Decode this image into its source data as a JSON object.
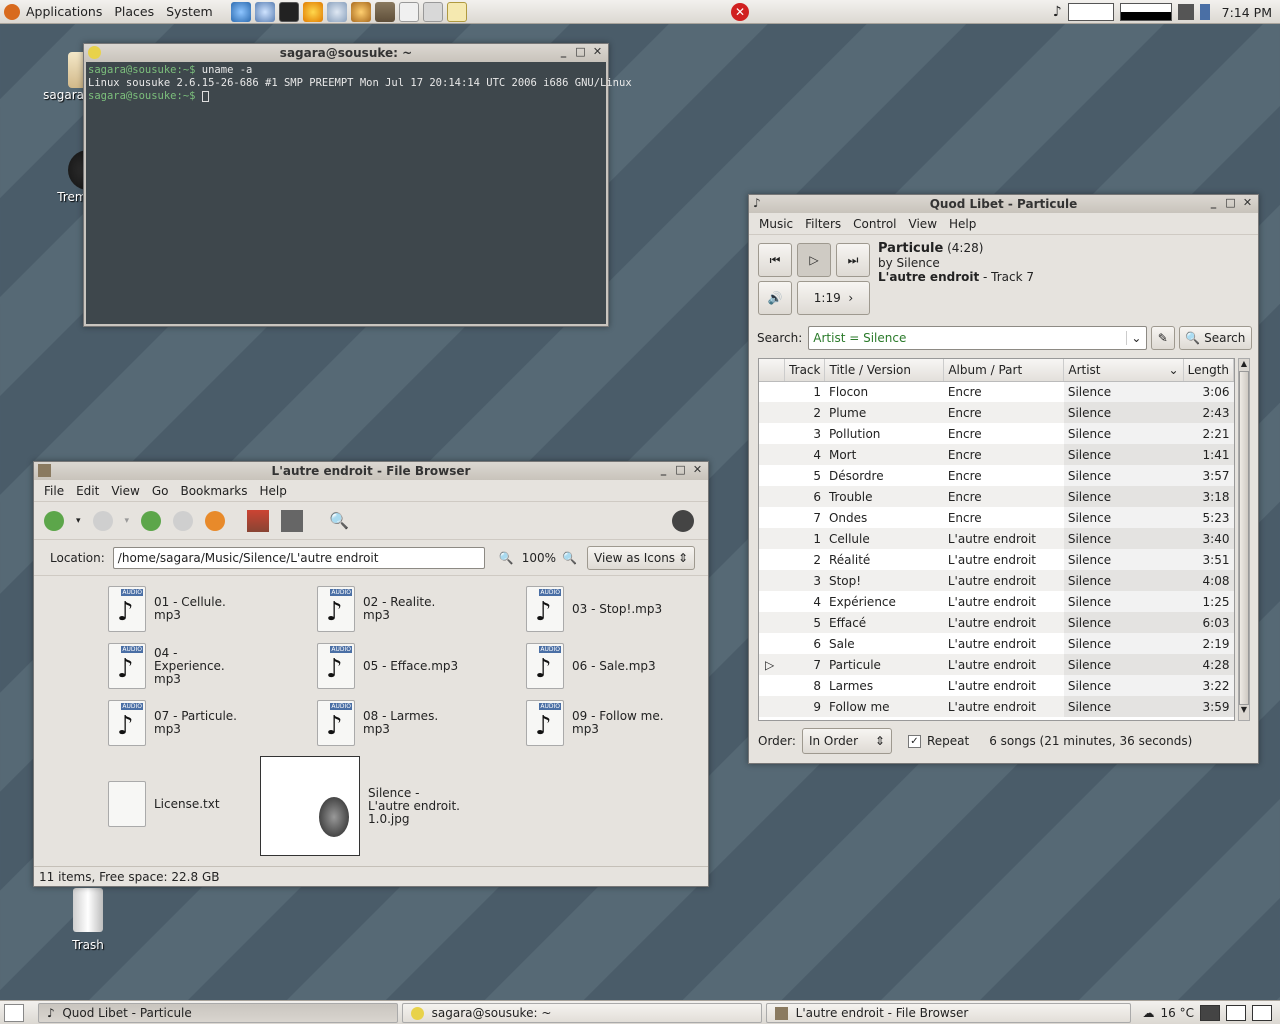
{
  "top_panel": {
    "menus": [
      "Applications",
      "Places",
      "System"
    ],
    "clock": "7:14 PM"
  },
  "desktop": {
    "icons": [
      "sagara's Home",
      "Tremulous",
      "Trash"
    ]
  },
  "terminal": {
    "title": "sagara@sousuke: ~",
    "line1_prompt": "sagara@sousuke:~$",
    "line1_cmd": " uname -a",
    "line2": "Linux sousuke 2.6.15-26-686 #1 SMP PREEMPT Mon Jul 17 20:14:14 UTC 2006 i686 GNU/Linux",
    "line3_prompt": "sagara@sousuke:~$"
  },
  "player": {
    "title": "Quod Libet - Particule",
    "menus": [
      "Music",
      "Filters",
      "Control",
      "View",
      "Help"
    ],
    "song": {
      "title": "Particule",
      "duration": "(4:28)",
      "by": "by Silence",
      "album": "L'autre endroit",
      "track": " - Track 7"
    },
    "position": "1:19",
    "search_label": "Search:",
    "search_value": "Artist = Silence",
    "search_button": "Search",
    "columns": [
      "Track",
      "Title / Version",
      "Album / Part",
      "Artist",
      "Length"
    ],
    "rows": [
      [
        "1",
        "Flocon",
        "Encre",
        "Silence",
        "3:06"
      ],
      [
        "2",
        "Plume",
        "Encre",
        "Silence",
        "2:43"
      ],
      [
        "3",
        "Pollution",
        "Encre",
        "Silence",
        "2:21"
      ],
      [
        "4",
        "Mort",
        "Encre",
        "Silence",
        "1:41"
      ],
      [
        "5",
        "Désordre",
        "Encre",
        "Silence",
        "3:57"
      ],
      [
        "6",
        "Trouble",
        "Encre",
        "Silence",
        "3:18"
      ],
      [
        "7",
        "Ondes",
        "Encre",
        "Silence",
        "5:23"
      ],
      [
        "1",
        "Cellule",
        "L'autre endroit",
        "Silence",
        "3:40"
      ],
      [
        "2",
        "Réalité",
        "L'autre endroit",
        "Silence",
        "3:51"
      ],
      [
        "3",
        "Stop!",
        "L'autre endroit",
        "Silence",
        "4:08"
      ],
      [
        "4",
        "Expérience",
        "L'autre endroit",
        "Silence",
        "1:25"
      ],
      [
        "5",
        "Effacé",
        "L'autre endroit",
        "Silence",
        "6:03"
      ],
      [
        "6",
        "Sale",
        "L'autre endroit",
        "Silence",
        "2:19"
      ],
      [
        "7",
        "Particule",
        "L'autre endroit",
        "Silence",
        "4:28"
      ],
      [
        "8",
        "Larmes",
        "L'autre endroit",
        "Silence",
        "3:22"
      ],
      [
        "9",
        "Follow me",
        "L'autre endroit",
        "Silence",
        "3:59"
      ]
    ],
    "playing_row": 13,
    "order_label": "Order:",
    "order_value": "In Order",
    "repeat_label": "Repeat",
    "status": "6 songs (21 minutes, 36 seconds)"
  },
  "filebrowser": {
    "title": "L'autre endroit - File Browser",
    "menus": [
      "File",
      "Edit",
      "View",
      "Go",
      "Bookmarks",
      "Help"
    ],
    "location_label": "Location:",
    "location_value": "/home/sagara/Music/Silence/L'autre endroit",
    "zoom": "100%",
    "view_mode": "View as Icons",
    "files": [
      "01 - Cellule.\nmp3",
      "02 - Realite.\nmp3",
      "03 - Stop!.mp3",
      "04 -\nExperience.\nmp3",
      "05 - Efface.mp3",
      "06 - Sale.mp3",
      "07 - Particule.\nmp3",
      "08 - Larmes.\nmp3",
      "09 - Follow me.\nmp3",
      "License.txt",
      "Silence -\nL'autre endroit.\n1.0.jpg"
    ],
    "audio_tag": "AUDIO",
    "status": "11 items, Free space: 22.8 GB"
  },
  "taskbar": {
    "tasks": [
      "Quod Libet - Particule",
      "sagara@sousuke: ~",
      "L'autre endroit - File Browser"
    ],
    "weather": "16 °C"
  }
}
